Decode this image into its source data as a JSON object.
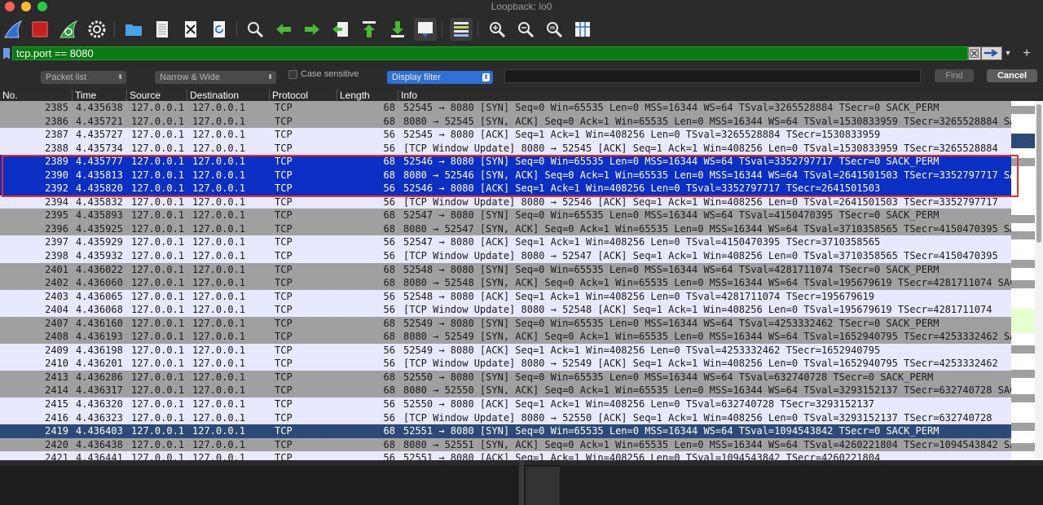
{
  "window": {
    "title": "Loopback: lo0"
  },
  "toolbar": {
    "icons": [
      "shark-fin-icon",
      "stop-icon",
      "restart-capture-icon",
      "capture-options-icon",
      "open-folder-icon",
      "save-file-icon",
      "close-file-icon",
      "reload-icon",
      "find-icon",
      "go-back-icon",
      "go-forward-icon",
      "go-to-packet-icon",
      "go-first-icon",
      "go-last-icon",
      "autoscroll-icon",
      "colorize-icon",
      "zoom-in-icon",
      "zoom-out-icon",
      "zoom-reset-icon",
      "resize-columns-icon"
    ]
  },
  "filter": {
    "value": "tcp.port == 8080",
    "accent": "#0a7a12"
  },
  "search": {
    "scope": "Packet list",
    "char_mode": "Narrow & Wide",
    "case_sensitive_label": "Case sensitive",
    "search_type": "Display filter",
    "find_label": "Find",
    "cancel_label": "Cancel"
  },
  "columns": {
    "no": "No.",
    "time": "Time",
    "source": "Source",
    "destination": "Destination",
    "protocol": "Protocol",
    "length": "Length",
    "info": "Info"
  },
  "packets": [
    {
      "no": "2385",
      "time": "4.435638",
      "src": "127.0.0.1",
      "dst": "127.0.0.1",
      "proto": "TCP",
      "len": "68",
      "info": "52545 → 8080 [SYN] Seq=0 Win=65535 Len=0 MSS=16344 WS=64 TSval=3265528884 TSecr=0 SACK_PERM",
      "style": "g"
    },
    {
      "no": "2386",
      "time": "4.435721",
      "src": "127.0.0.1",
      "dst": "127.0.0.1",
      "proto": "TCP",
      "len": "68",
      "info": "8080 → 52545 [SYN, ACK] Seq=0 Ack=1 Win=65535 Len=0 MSS=16344 WS=64 TSval=1530833959 TSecr=3265528884 SA",
      "style": "g"
    },
    {
      "no": "2387",
      "time": "4.435727",
      "src": "127.0.0.1",
      "dst": "127.0.0.1",
      "proto": "TCP",
      "len": "56",
      "info": "52545 → 8080 [ACK] Seq=1 Ack=1 Win=408256 Len=0 TSval=3265528884 TSecr=1530833959",
      "style": "a"
    },
    {
      "no": "2388",
      "time": "4.435734",
      "src": "127.0.0.1",
      "dst": "127.0.0.1",
      "proto": "TCP",
      "len": "56",
      "info": "[TCP Window Update] 8080 → 52545 [ACK] Seq=1 Ack=1 Win=408256 Len=0 TSval=1530833959 TSecr=3265528884",
      "style": "a"
    },
    {
      "no": "2389",
      "time": "4.435777",
      "src": "127.0.0.1",
      "dst": "127.0.0.1",
      "proto": "TCP",
      "len": "68",
      "info": "52546 → 8080 [SYN] Seq=0 Win=65535 Len=0 MSS=16344 WS=64 TSval=3352797717 TSecr=0 SACK_PERM",
      "style": "sel"
    },
    {
      "no": "2390",
      "time": "4.435813",
      "src": "127.0.0.1",
      "dst": "127.0.0.1",
      "proto": "TCP",
      "len": "68",
      "info": "8080 → 52546 [SYN, ACK] Seq=0 Ack=1 Win=65535 Len=0 MSS=16344 WS=64 TSval=2641501503 TSecr=3352797717 SA",
      "style": "sel"
    },
    {
      "no": "2392",
      "time": "4.435820",
      "src": "127.0.0.1",
      "dst": "127.0.0.1",
      "proto": "TCP",
      "len": "56",
      "info": "52546 → 8080 [ACK] Seq=1 Ack=1 Win=408256 Len=0 TSval=3352797717 TSecr=2641501503",
      "style": "sel"
    },
    {
      "no": "2394",
      "time": "4.435832",
      "src": "127.0.0.1",
      "dst": "127.0.0.1",
      "proto": "TCP",
      "len": "56",
      "info": "[TCP Window Update] 8080 → 52546 [ACK] Seq=1 Ack=1 Win=408256 Len=0 TSval=2641501503 TSecr=3352797717",
      "style": "a"
    },
    {
      "no": "2395",
      "time": "4.435893",
      "src": "127.0.0.1",
      "dst": "127.0.0.1",
      "proto": "TCP",
      "len": "68",
      "info": "52547 → 8080 [SYN] Seq=0 Win=65535 Len=0 MSS=16344 WS=64 TSval=4150470395 TSecr=0 SACK_PERM",
      "style": "g"
    },
    {
      "no": "2396",
      "time": "4.435925",
      "src": "127.0.0.1",
      "dst": "127.0.0.1",
      "proto": "TCP",
      "len": "68",
      "info": "8080 → 52547 [SYN, ACK] Seq=0 Ack=1 Win=65535 Len=0 MSS=16344 WS=64 TSval=3710358565 TSecr=4150470395 SA",
      "style": "g"
    },
    {
      "no": "2397",
      "time": "4.435929",
      "src": "127.0.0.1",
      "dst": "127.0.0.1",
      "proto": "TCP",
      "len": "56",
      "info": "52547 → 8080 [ACK] Seq=1 Ack=1 Win=408256 Len=0 TSval=4150470395 TSecr=3710358565",
      "style": "a"
    },
    {
      "no": "2398",
      "time": "4.435932",
      "src": "127.0.0.1",
      "dst": "127.0.0.1",
      "proto": "TCP",
      "len": "56",
      "info": "[TCP Window Update] 8080 → 52547 [ACK] Seq=1 Ack=1 Win=408256 Len=0 TSval=3710358565 TSecr=4150470395",
      "style": "a"
    },
    {
      "no": "2401",
      "time": "4.436022",
      "src": "127.0.0.1",
      "dst": "127.0.0.1",
      "proto": "TCP",
      "len": "68",
      "info": "52548 → 8080 [SYN] Seq=0 Win=65535 Len=0 MSS=16344 WS=64 TSval=4281711074 TSecr=0 SACK_PERM",
      "style": "g"
    },
    {
      "no": "2402",
      "time": "4.436060",
      "src": "127.0.0.1",
      "dst": "127.0.0.1",
      "proto": "TCP",
      "len": "68",
      "info": "8080 → 52548 [SYN, ACK] Seq=0 Ack=1 Win=65535 Len=0 MSS=16344 WS=64 TSval=195679619 TSecr=4281711074 SAC",
      "style": "g"
    },
    {
      "no": "2403",
      "time": "4.436065",
      "src": "127.0.0.1",
      "dst": "127.0.0.1",
      "proto": "TCP",
      "len": "56",
      "info": "52548 → 8080 [ACK] Seq=1 Ack=1 Win=408256 Len=0 TSval=4281711074 TSecr=195679619",
      "style": "a"
    },
    {
      "no": "2404",
      "time": "4.436068",
      "src": "127.0.0.1",
      "dst": "127.0.0.1",
      "proto": "TCP",
      "len": "56",
      "info": "[TCP Window Update] 8080 → 52548 [ACK] Seq=1 Ack=1 Win=408256 Len=0 TSval=195679619 TSecr=4281711074",
      "style": "a"
    },
    {
      "no": "2407",
      "time": "4.436160",
      "src": "127.0.0.1",
      "dst": "127.0.0.1",
      "proto": "TCP",
      "len": "68",
      "info": "52549 → 8080 [SYN] Seq=0 Win=65535 Len=0 MSS=16344 WS=64 TSval=4253332462 TSecr=0 SACK_PERM",
      "style": "g"
    },
    {
      "no": "2408",
      "time": "4.436193",
      "src": "127.0.0.1",
      "dst": "127.0.0.1",
      "proto": "TCP",
      "len": "68",
      "info": "8080 → 52549 [SYN, ACK] Seq=0 Ack=1 Win=65535 Len=0 MSS=16344 WS=64 TSval=1652940795 TSecr=4253332462 SA",
      "style": "g"
    },
    {
      "no": "2409",
      "time": "4.436198",
      "src": "127.0.0.1",
      "dst": "127.0.0.1",
      "proto": "TCP",
      "len": "56",
      "info": "52549 → 8080 [ACK] Seq=1 Ack=1 Win=408256 Len=0 TSval=4253332462 TSecr=1652940795",
      "style": "a"
    },
    {
      "no": "2410",
      "time": "4.436201",
      "src": "127.0.0.1",
      "dst": "127.0.0.1",
      "proto": "TCP",
      "len": "56",
      "info": "[TCP Window Update] 8080 → 52549 [ACK] Seq=1 Ack=1 Win=408256 Len=0 TSval=1652940795 TSecr=4253332462",
      "style": "a"
    },
    {
      "no": "2413",
      "time": "4.436286",
      "src": "127.0.0.1",
      "dst": "127.0.0.1",
      "proto": "TCP",
      "len": "68",
      "info": "52550 → 8080 [SYN] Seq=0 Win=65535 Len=0 MSS=16344 WS=64 TSval=632740728 TSecr=0 SACK_PERM",
      "style": "g"
    },
    {
      "no": "2414",
      "time": "4.436317",
      "src": "127.0.0.1",
      "dst": "127.0.0.1",
      "proto": "TCP",
      "len": "68",
      "info": "8080 → 52550 [SYN, ACK] Seq=0 Ack=1 Win=65535 Len=0 MSS=16344 WS=64 TSval=3293152137 TSecr=632740728 SAC",
      "style": "g"
    },
    {
      "no": "2415",
      "time": "4.436320",
      "src": "127.0.0.1",
      "dst": "127.0.0.1",
      "proto": "TCP",
      "len": "56",
      "info": "52550 → 8080 [ACK] Seq=1 Ack=1 Win=408256 Len=0 TSval=632740728 TSecr=3293152137",
      "style": "a"
    },
    {
      "no": "2416",
      "time": "4.436323",
      "src": "127.0.0.1",
      "dst": "127.0.0.1",
      "proto": "TCP",
      "len": "56",
      "info": "[TCP Window Update] 8080 → 52550 [ACK] Seq=1 Ack=1 Win=408256 Len=0 TSval=3293152137 TSecr=632740728",
      "style": "a"
    },
    {
      "no": "2419",
      "time": "4.436403",
      "src": "127.0.0.1",
      "dst": "127.0.0.1",
      "proto": "TCP",
      "len": "68",
      "info": "52551 → 8080 [SYN] Seq=0 Win=65535 Len=0 MSS=16344 WS=64 TSval=1094543842 TSecr=0 SACK_PERM",
      "style": "dark"
    },
    {
      "no": "2420",
      "time": "4.436438",
      "src": "127.0.0.1",
      "dst": "127.0.0.1",
      "proto": "TCP",
      "len": "68",
      "info": "8080 → 52551 [SYN, ACK] Seq=0 Ack=1 Win=65535 Len=0 MSS=16344 WS=64 TSval=4260221804 TSecr=1094543842 SA",
      "style": "g"
    },
    {
      "no": "2421",
      "time": "4.436441",
      "src": "127.0.0.1",
      "dst": "127.0.0.1",
      "proto": "TCP",
      "len": "56",
      "info": "52551 → 8080 [ACK] Seq=1 Ack=1 Win=408256 Len=0 TSval=1094543842 TSecr=4260221804",
      "style": "a"
    }
  ],
  "colors": {
    "row_alt": "#e8e8ff",
    "row_gray": "#a0a0a0",
    "row_selected": "#0a2fc2",
    "row_current": "#2b4a78",
    "annotation_box": "#e03030"
  }
}
